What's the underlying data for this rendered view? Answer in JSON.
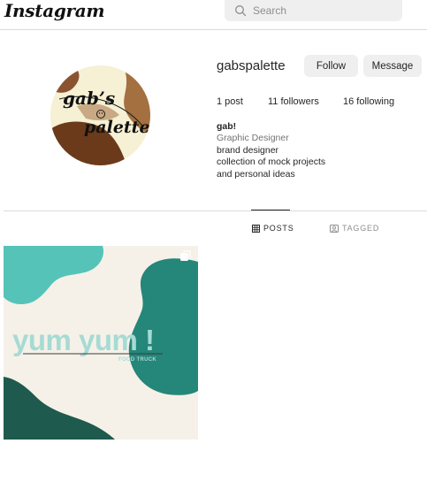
{
  "app": {
    "logo": "Instagram"
  },
  "search": {
    "placeholder": "Search",
    "icon": "search-icon"
  },
  "profile": {
    "username": "gabspalette",
    "avatar_text_line1": "gab’s",
    "avatar_text_line2": "palette",
    "follow_label": "Follow",
    "message_label": "Message",
    "stats": {
      "posts": "1 post",
      "followers": "11 followers",
      "following": "16 following"
    },
    "bio": {
      "name": "gab!",
      "category": "Graphic Designer",
      "lines": [
        "brand designer",
        "collection of mock projects",
        "and personal ideas"
      ]
    }
  },
  "tabs": [
    {
      "label": "POSTS",
      "icon": "grid-icon",
      "active": true
    },
    {
      "label": "TAGGED",
      "icon": "tag-icon",
      "active": false
    }
  ],
  "posts": [
    {
      "title": "yum yum !",
      "subtitle": "FOOD TRUCK",
      "icon": "multiple-posts-icon"
    }
  ],
  "colors": {
    "teal_light": "#56c3b8",
    "teal_dark": "#25867a",
    "green_dark": "#1f5a4e",
    "cream": "#f5f1e8",
    "mint_text": "#a6dbd4",
    "avatar_brown_dark": "#6b3a1a",
    "avatar_brown_mid": "#a4703f",
    "avatar_cream": "#f6f0d4"
  }
}
